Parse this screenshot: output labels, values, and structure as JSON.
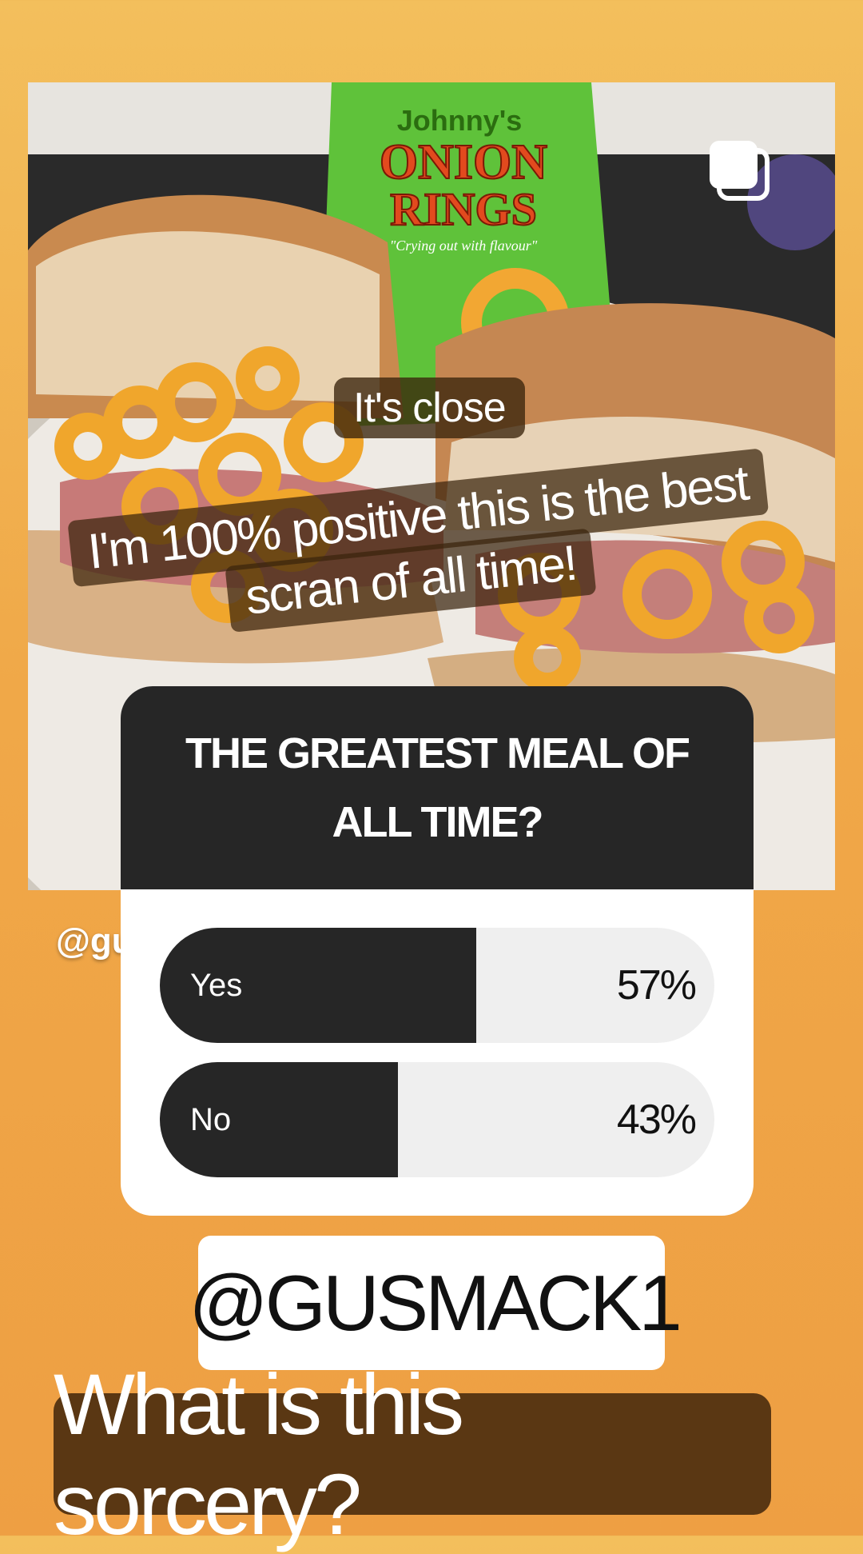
{
  "stickers": {
    "close_text": "It's close",
    "positive_line1": "I'm 100% positive this is the best",
    "positive_line2": "scran of all time!"
  },
  "photo": {
    "bag_brand": "Johnny's",
    "bag_title_line1": "ONION",
    "bag_title_line2": "RINGS",
    "bag_tagline": "\"Crying out with flavour\"",
    "multi_icon": "carousel-stack-icon"
  },
  "handle_peek": "@gu",
  "poll": {
    "question": "THE GREATEST MEAL OF ALL TIME?",
    "options": [
      {
        "label": "Yes",
        "percent_text": "57%",
        "percent": 57
      },
      {
        "label": "No",
        "percent_text": "43%",
        "percent": 43
      }
    ]
  },
  "mention": {
    "icon": "threads-icon",
    "text": "@GUSMACK1"
  },
  "caption": "What is this sorcery?",
  "colors": {
    "background_top": "#f3bf5c",
    "background_bottom": "#ee9f43",
    "poll_dark": "#262626",
    "poll_track": "#efefef",
    "sticker_brown": "#5a3713"
  }
}
